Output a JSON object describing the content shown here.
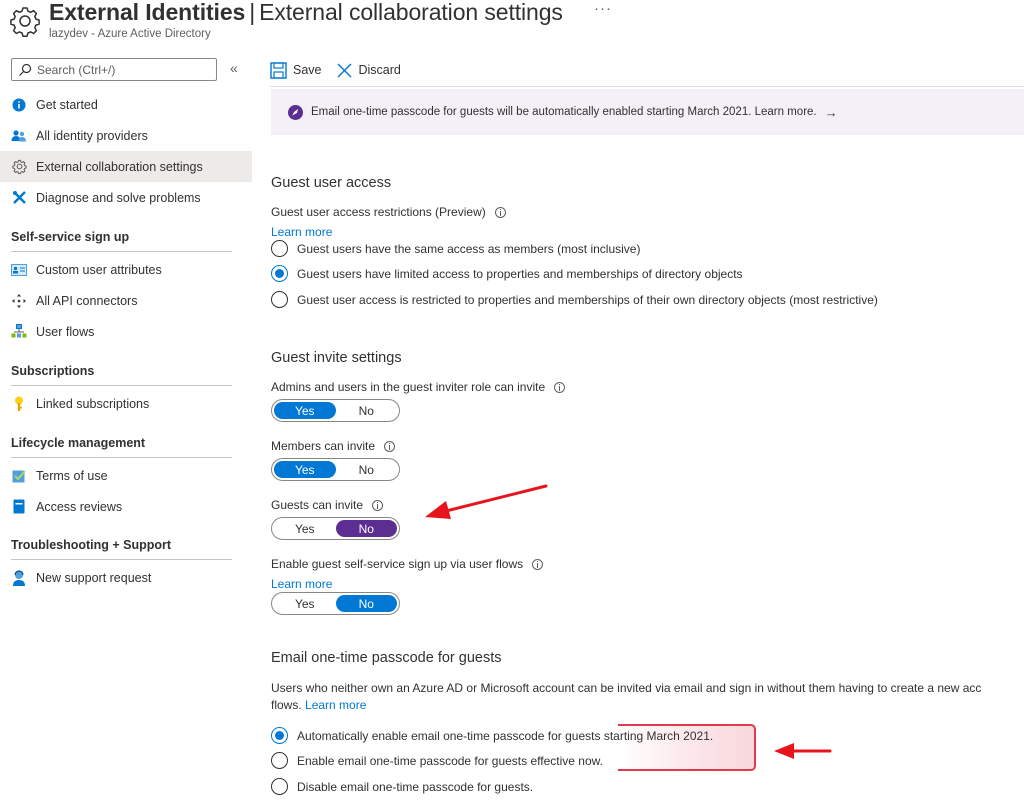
{
  "header": {
    "title_bold": "External Identities",
    "separator": "|",
    "title_rest": "External collaboration settings",
    "more": "···",
    "subtitle": "lazydev - Azure Active Directory"
  },
  "sidebar": {
    "search_placeholder": "Search (Ctrl+/)",
    "collapse_glyph": "«",
    "items": [
      {
        "label": "Get started",
        "icon": "info-icon"
      },
      {
        "label": "All identity providers",
        "icon": "users-icon"
      },
      {
        "label": "External collaboration settings",
        "icon": "gear-icon",
        "active": true
      },
      {
        "label": "Diagnose and solve problems",
        "icon": "wrench-icon"
      }
    ],
    "sections": [
      {
        "title": "Self-service sign up",
        "items": [
          {
            "label": "Custom user attributes",
            "icon": "id-card-icon"
          },
          {
            "label": "All API connectors",
            "icon": "connectors-icon"
          },
          {
            "label": "User flows",
            "icon": "flow-icon"
          }
        ]
      },
      {
        "title": "Subscriptions",
        "items": [
          {
            "label": "Linked subscriptions",
            "icon": "key-icon"
          }
        ]
      },
      {
        "title": "Lifecycle management",
        "items": [
          {
            "label": "Terms of use",
            "icon": "checkbox-icon"
          },
          {
            "label": "Access reviews",
            "icon": "book-icon"
          }
        ]
      },
      {
        "title": "Troubleshooting + Support",
        "items": [
          {
            "label": "New support request",
            "icon": "support-person-icon"
          }
        ]
      }
    ]
  },
  "toolbar": {
    "save_label": "Save",
    "discard_label": "Discard"
  },
  "banner": {
    "text": "Email one-time passcode for guests will be automatically enabled starting March 2021. Learn more.",
    "arrow": "→"
  },
  "guest_access": {
    "title": "Guest user access",
    "restrictions_label": "Guest user access restrictions (Preview)",
    "learn_more": "Learn more",
    "options": [
      {
        "label": "Guest users have the same access as members (most inclusive)",
        "checked": false
      },
      {
        "label": "Guest users have limited access to properties and memberships of directory objects",
        "checked": true
      },
      {
        "label": "Guest user access is restricted to properties and memberships of their own directory objects (most restrictive)",
        "checked": false
      }
    ]
  },
  "invite_settings": {
    "title": "Guest invite settings",
    "toggles": [
      {
        "label": "Admins and users in the guest inviter role can invite",
        "yes": "Yes",
        "no": "No",
        "value": "Yes"
      },
      {
        "label": "Members can invite",
        "yes": "Yes",
        "no": "No",
        "value": "Yes"
      },
      {
        "label": "Guests can invite",
        "yes": "Yes",
        "no": "No",
        "value": "No"
      },
      {
        "label": "Enable guest self-service sign up via user flows",
        "yes": "Yes",
        "no": "No",
        "value": "No",
        "learn_more": "Learn more"
      }
    ]
  },
  "otp": {
    "title": "Email one-time passcode for guests",
    "description_line1": "Users who neither own an Azure AD or Microsoft account can be invited via email and sign in without them having to create a new acc",
    "description_line2": "flows.",
    "learn_more": "Learn more",
    "options": [
      {
        "label": "Automatically enable email one-time passcode for guests starting March 2021.",
        "checked": true
      },
      {
        "label": "Enable email one-time passcode for guests effective now.",
        "checked": false
      },
      {
        "label": "Disable email one-time passcode for guests.",
        "checked": false
      }
    ]
  },
  "colors": {
    "accent_blue": "#0078d4",
    "toggle_purple": "#5c2e91",
    "banner_bg": "#f4f0f7",
    "annotation_red": "#e8141c"
  }
}
